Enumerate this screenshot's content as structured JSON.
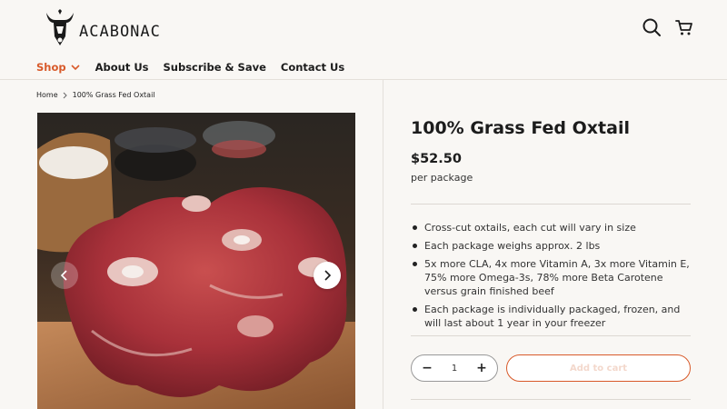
{
  "brand": {
    "name": "ACABONAC"
  },
  "header": {
    "search_icon": "search-icon",
    "cart_icon": "cart-icon"
  },
  "nav": {
    "items": [
      {
        "label": "Shop",
        "active": true,
        "has_dropdown": true
      },
      {
        "label": "About Us"
      },
      {
        "label": "Subscribe & Save"
      },
      {
        "label": "Contact Us"
      }
    ]
  },
  "breadcrumb": {
    "home": "Home",
    "current": "100% Grass Fed Oxtail"
  },
  "product": {
    "title": "100% Grass Fed Oxtail",
    "price": "$52.50",
    "unit": "per package",
    "bullets": [
      "Cross-cut oxtails, each cut will vary in size",
      "Each package weighs approx. 2 lbs",
      "5x more CLA, 4x more Vitamin A, 3x more Vitamin E, 75% more Omega-3s, 78% more Beta Carotene versus grain finished beef",
      "Each package is individually packaged, frozen, and will last about 1 year in your freezer"
    ]
  },
  "purchase": {
    "quantity": "1",
    "minus": "−",
    "plus": "+",
    "add_to_cart": "Add to cart"
  },
  "colors": {
    "accent": "#d85a2a",
    "background": "#f9f7f4"
  }
}
